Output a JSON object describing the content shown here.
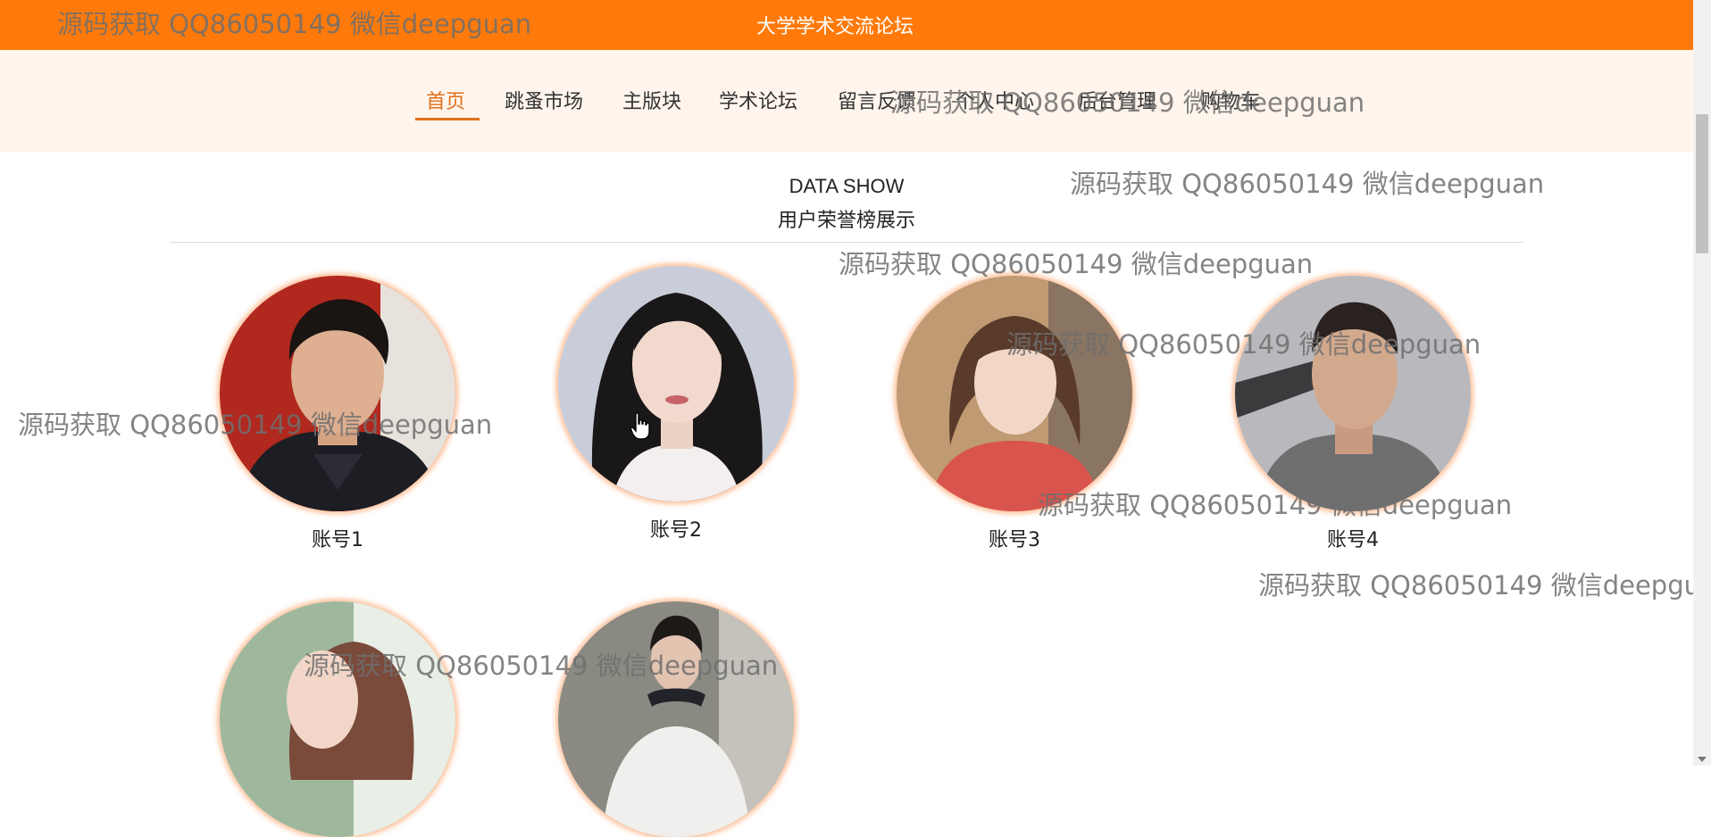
{
  "header": {
    "title": "大学学术交流论坛"
  },
  "nav": {
    "items": [
      {
        "label": "首页",
        "active": true
      },
      {
        "label": "跳蚤市场"
      },
      {
        "label": "主版块"
      },
      {
        "label": "学术论坛"
      },
      {
        "label": "留言反馈"
      },
      {
        "label": "个人中心"
      },
      {
        "label": "后台管理"
      },
      {
        "label": "购物车"
      }
    ]
  },
  "section": {
    "title_en": "DATA SHOW",
    "title_cn": "用户荣誉榜展示"
  },
  "accounts": [
    {
      "label": "账号1"
    },
    {
      "label": "账号2"
    },
    {
      "label": "账号3"
    },
    {
      "label": "账号4"
    },
    {
      "label": ""
    },
    {
      "label": ""
    }
  ],
  "watermark": "源码获取 QQ86050149 微信deepguan",
  "colors": {
    "header": "#ff7a0a",
    "accent": "#e0701b",
    "nav_bg": "#fff5ec"
  }
}
